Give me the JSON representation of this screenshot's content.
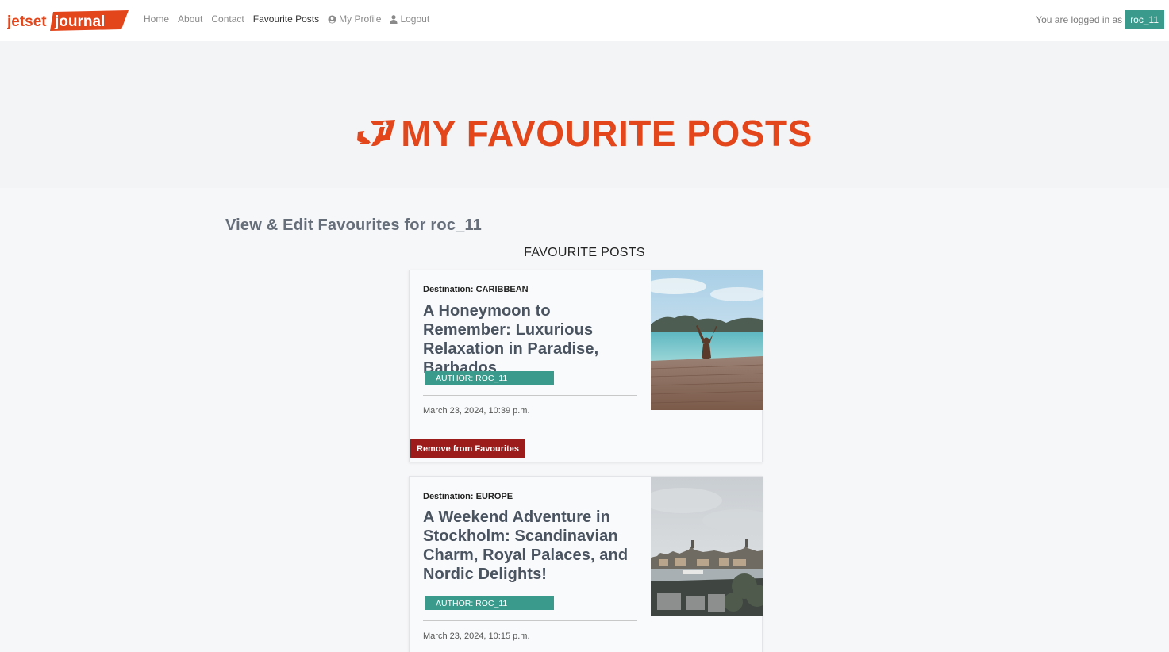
{
  "brand": {
    "logo_text_left": "jetset",
    "logo_text_right": "journal",
    "accent": "#e4461b",
    "teal": "#3a9a8c"
  },
  "nav": {
    "links": [
      {
        "label": "Home",
        "icon": null
      },
      {
        "label": "About",
        "icon": null
      },
      {
        "label": "Contact",
        "icon": null
      },
      {
        "label": "Favourite Posts",
        "icon": null,
        "active": true
      },
      {
        "label": "My Profile",
        "icon": "user-circle-icon"
      },
      {
        "label": "Logout",
        "icon": "user-icon"
      }
    ],
    "logged_in_text": "You are logged in as",
    "username": "roc_11"
  },
  "hero": {
    "title": "MY FAVOURITE POSTS"
  },
  "page": {
    "subheading": "View & Edit Favourites for roc_11",
    "section_title": "FAVOURITE POSTS"
  },
  "posts": [
    {
      "destination": "Destination: CARIBBEAN",
      "title": "A Honeymoon to Remember: Luxurious Relaxation in Paradise, Barbados",
      "author": "AUTHOR: ROC_11",
      "date": "March 23, 2024, 10:39 p.m.",
      "button": "Remove from Favourites",
      "image": "beach-pier-image"
    },
    {
      "destination": "Destination: EUROPE",
      "title": "A Weekend Adventure in Stockholm: Scandinavian Charm, Royal Palaces, and Nordic Delights!",
      "author": "AUTHOR: ROC_11",
      "date": "March 23, 2024, 10:15 p.m.",
      "image": "stockholm-city-image"
    }
  ],
  "colors": {
    "remove_button": "#9c1c1c",
    "title_text": "#4a5360"
  }
}
